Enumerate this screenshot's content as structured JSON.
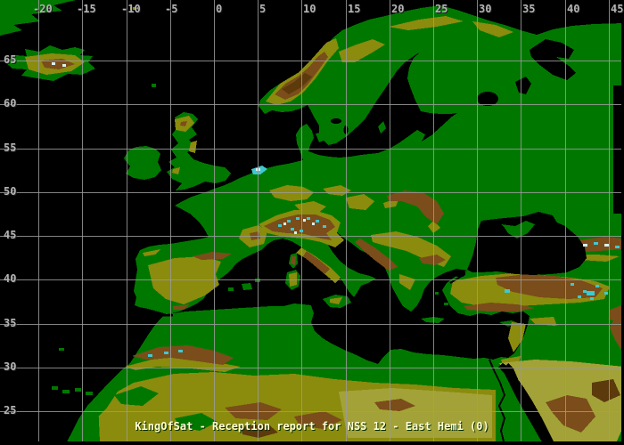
{
  "caption": {
    "text": "KingOfSat - Reception report for NSS 12 - East Hemi (0)"
  },
  "axes": {
    "top_longitude": {
      "ticks": [
        {
          "label": "-20",
          "deg": -20
        },
        {
          "label": "-15",
          "deg": -15
        },
        {
          "label": "-10",
          "deg": -10
        },
        {
          "label": "-5",
          "deg": -5
        },
        {
          "label": "0",
          "deg": 0
        },
        {
          "label": "5",
          "deg": 5
        },
        {
          "label": "10",
          "deg": 10
        },
        {
          "label": "15",
          "deg": 15
        },
        {
          "label": "20",
          "deg": 20
        },
        {
          "label": "25",
          "deg": 25
        },
        {
          "label": "30",
          "deg": 30
        },
        {
          "label": "35",
          "deg": 35
        },
        {
          "label": "40",
          "deg": 40
        },
        {
          "label": "45",
          "deg": 45
        }
      ]
    },
    "left_latitude": {
      "ticks": [
        {
          "label": "65",
          "deg": 65
        },
        {
          "label": "60",
          "deg": 60
        },
        {
          "label": "55",
          "deg": 55
        },
        {
          "label": "50",
          "deg": 50
        },
        {
          "label": "45",
          "deg": 45
        },
        {
          "label": "40",
          "deg": 40
        },
        {
          "label": "35",
          "deg": 35
        },
        {
          "label": "30",
          "deg": 30
        },
        {
          "label": "25",
          "deg": 25
        }
      ]
    }
  },
  "palette": {
    "sea": "#000000",
    "lowland_green": "#007800",
    "upland_olive": "#8b8b0e",
    "desert_light_olive": "#a2a238",
    "highland_brown": "#7b4d1a",
    "dark_brown": "#5c3a0c",
    "lake_peak_cyan": "#3fc8d0",
    "glacier_white": "#d9f0f0",
    "grid_line": "#9a9a9a",
    "axis_label": "#b4b4b4",
    "caption_text": "#ffffd4"
  }
}
